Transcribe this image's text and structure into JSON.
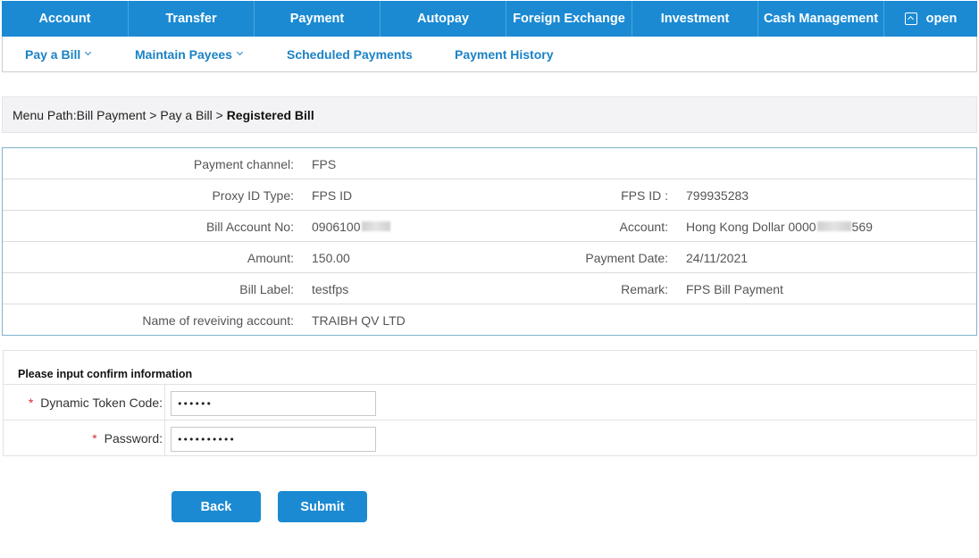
{
  "topnav": {
    "tabs": [
      {
        "label": "Account"
      },
      {
        "label": "Transfer"
      },
      {
        "label": "Payment"
      },
      {
        "label": "Autopay"
      },
      {
        "label": "Foreign Exchange"
      },
      {
        "label": "Investment"
      },
      {
        "label": "Cash Management"
      }
    ],
    "open_label": "open"
  },
  "subnav": {
    "items": [
      {
        "label": "Pay a Bill"
      },
      {
        "label": "Maintain Payees"
      },
      {
        "label": "Scheduled Payments"
      },
      {
        "label": "Payment History"
      }
    ]
  },
  "breadcrumb": {
    "prefix": "Menu Path:Bill Payment > Pay a Bill > ",
    "current": "Registered Bill"
  },
  "details": {
    "payment_channel": {
      "label": "Payment channel:",
      "value": "FPS"
    },
    "proxy_id_type": {
      "label": "Proxy ID Type:",
      "value": "FPS ID"
    },
    "fps_id": {
      "label": "FPS ID :",
      "value": "799935283"
    },
    "bill_account_no": {
      "label": "Bill Account No:",
      "value_prefix": "0906100"
    },
    "account": {
      "label": "Account:",
      "value_prefix": "Hong Kong Dollar 0000",
      "value_suffix": "569"
    },
    "amount": {
      "label": "Amount:",
      "value": "150.00"
    },
    "payment_date": {
      "label": "Payment Date:",
      "value": "24/11/2021"
    },
    "bill_label": {
      "label": "Bill Label:",
      "value": "testfps"
    },
    "remark": {
      "label": "Remark:",
      "value": "FPS Bill Payment"
    },
    "receiving_account_name": {
      "label": "Name of reveiving account:",
      "value": "TRAIBH QV LTD"
    }
  },
  "confirm": {
    "title": "Please input confirm information",
    "token": {
      "label": "Dynamic Token Code:",
      "value": "••••••"
    },
    "password": {
      "label": "Password:",
      "value": "••••••••••"
    }
  },
  "buttons": {
    "back": "Back",
    "submit": "Submit"
  },
  "colors": {
    "brand_blue": "#1b8ad3",
    "link_blue": "#1b82c4",
    "required_red": "#d0312d"
  }
}
